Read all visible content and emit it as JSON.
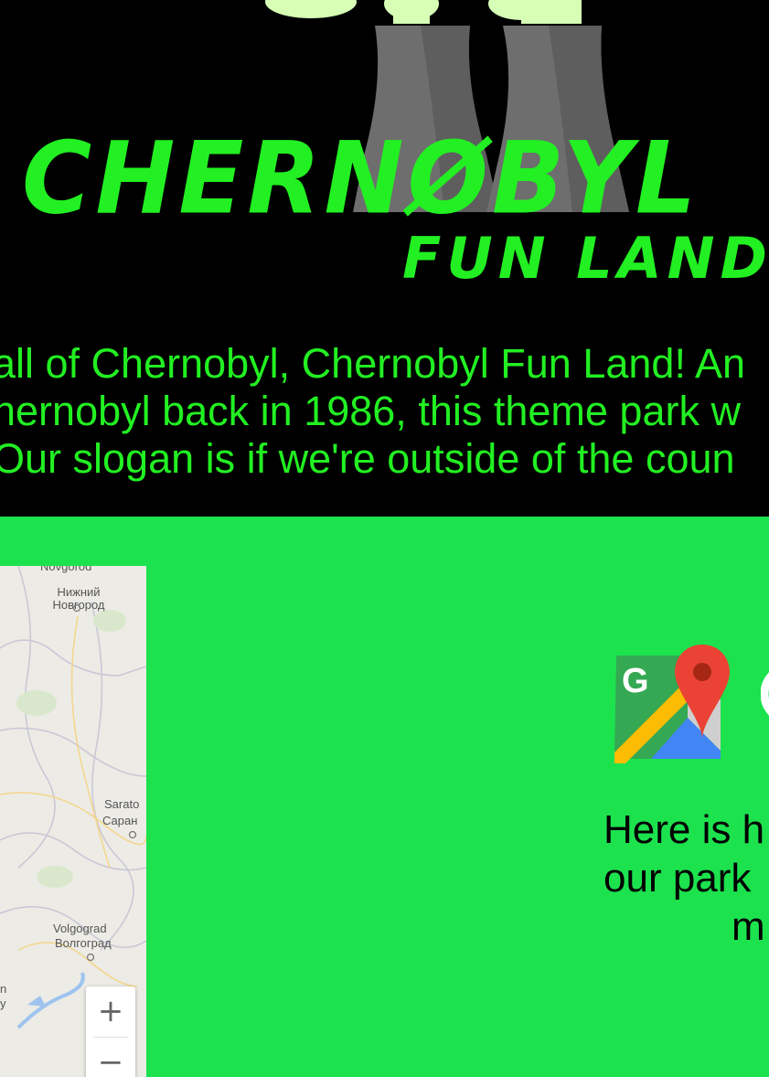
{
  "hero": {
    "logo_title": "CHERNØBYL",
    "logo_subtitle": "FUN LAND",
    "intro_lines": [
      "all of Chernobyl, Chernobyl Fun Land! An",
      "hernobyl back in 1986, this theme park w",
      "Our slogan is if we're outside of the coun"
    ]
  },
  "map": {
    "cities": [
      {
        "latin": "Novgorod",
        "cyrillic": "Нижний\nНовгород"
      },
      {
        "latin": "Sarato",
        "cyrillic": "Саран"
      },
      {
        "latin": "Volgograd",
        "cyrillic": "Волгоград"
      },
      {
        "latin": "n",
        "cyrillic": "y"
      }
    ],
    "zoom_in_label": "+",
    "zoom_out_label": "−"
  },
  "directions": {
    "lines": [
      "Here is h",
      "our park",
      "m"
    ]
  },
  "colors": {
    "hero_bg": "#000000",
    "neon_green": "#22f022",
    "section_green": "#1ce24e",
    "map_bg": "#ecebe5",
    "tower_grey": "#6e6e6e",
    "smoke": "#d6ffb5"
  },
  "icons": {
    "cooling_towers": "cooling-towers-icon",
    "google_maps_logo": "google-maps-icon"
  }
}
